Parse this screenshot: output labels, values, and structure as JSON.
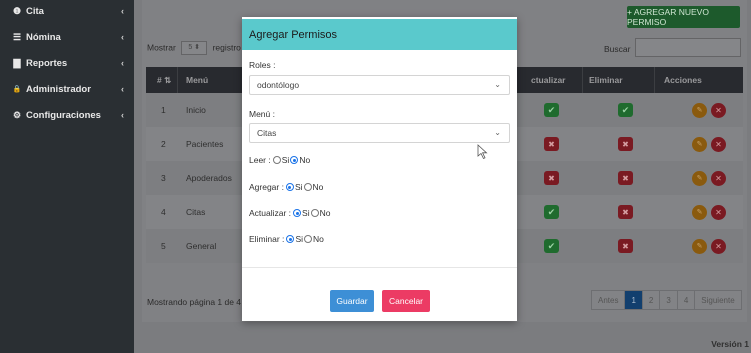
{
  "sidebar": {
    "items": [
      {
        "icon": "info-circle-icon",
        "glyph": "❶",
        "label": "Cita"
      },
      {
        "icon": "list-icon",
        "glyph": "☰",
        "label": "Nómina"
      },
      {
        "icon": "file-icon",
        "glyph": "▇",
        "label": "Reportes"
      },
      {
        "icon": "lock-icon",
        "glyph": "🔒",
        "label": "Administrador"
      },
      {
        "icon": "gears-icon",
        "glyph": "⚙",
        "label": "Configuraciones"
      }
    ]
  },
  "toolbar": {
    "add_label": "+ AGREGAR NUEVO PERMISO"
  },
  "table_controls": {
    "show_label": "Mostrar",
    "show_value": "5",
    "records_label": "registro",
    "search_label": "Buscar"
  },
  "table": {
    "headers": [
      "# ⇅",
      "Menú",
      "ctualizar",
      "Eliminar",
      "Acciones"
    ],
    "rows": [
      {
        "num": "1",
        "menu": "Inicio",
        "actualizar": true,
        "eliminar": true
      },
      {
        "num": "2",
        "menu": "Pacientes",
        "actualizar": false,
        "eliminar": false
      },
      {
        "num": "3",
        "menu": "Apoderados",
        "actualizar": false,
        "eliminar": false
      },
      {
        "num": "4",
        "menu": "Citas",
        "actualizar": true,
        "eliminar": false
      },
      {
        "num": "5",
        "menu": "General",
        "actualizar": true,
        "eliminar": false
      }
    ],
    "footer_info": "Mostrando página 1 de 4"
  },
  "pagination": {
    "prev": "Antes",
    "pages": [
      "1",
      "2",
      "3",
      "4"
    ],
    "active": "1",
    "next": "Siguiente"
  },
  "version_label": "Versión 1",
  "modal": {
    "title": "Agregar Permisos",
    "roles_label": "Roles :",
    "roles_value": "odontólogo",
    "menu_label": "Menú :",
    "menu_value": "Citas",
    "permissions": [
      {
        "label": "Leer :",
        "selected": "No"
      },
      {
        "label": "Agregar :",
        "selected": "Si"
      },
      {
        "label": "Actualizar :",
        "selected": "Si"
      },
      {
        "label": "Eliminar :",
        "selected": "Si"
      }
    ],
    "opt_yes": "Si",
    "opt_no": "No",
    "save_label": "Guardar",
    "cancel_label": "Cancelar"
  },
  "colors": {
    "modal_header": "#5ac9cc",
    "save_button": "#3d8fd6",
    "cancel_button": "#ec3b64",
    "add_button": "#28a745",
    "sidebar": "#343a40"
  }
}
